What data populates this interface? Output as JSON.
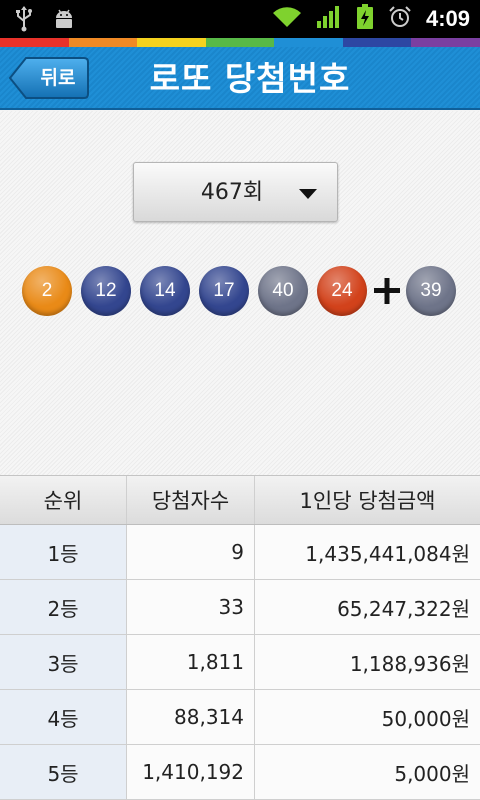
{
  "status": {
    "time": "4:09"
  },
  "rainbow": [
    "#e8322a",
    "#f08a25",
    "#f5d21e",
    "#58b947",
    "#1f8fd6",
    "#2d47a3",
    "#7b3fa1"
  ],
  "header": {
    "back_label": "뒤로",
    "title": "로또 당첨번호"
  },
  "round": {
    "label": "467회"
  },
  "balls": [
    {
      "number": "2",
      "color": "#e98a17"
    },
    {
      "number": "12",
      "color": "#33468f"
    },
    {
      "number": "14",
      "color": "#33468f"
    },
    {
      "number": "17",
      "color": "#33468f"
    },
    {
      "number": "40",
      "color": "#6e7489"
    },
    {
      "number": "24",
      "color": "#d2421b"
    }
  ],
  "bonus": {
    "number": "39",
    "color": "#6e7489"
  },
  "table": {
    "headers": [
      "순위",
      "당첨자수",
      "1인당 당첨금액"
    ],
    "rows": [
      {
        "rank": "1등",
        "winners": "9",
        "prize": "1,435,441,084원"
      },
      {
        "rank": "2등",
        "winners": "33",
        "prize": "65,247,322원"
      },
      {
        "rank": "3등",
        "winners": "1,811",
        "prize": "1,188,936원"
      },
      {
        "rank": "4등",
        "winners": "88,314",
        "prize": "50,000원"
      },
      {
        "rank": "5등",
        "winners": "1,410,192",
        "prize": "5,000원"
      }
    ]
  }
}
